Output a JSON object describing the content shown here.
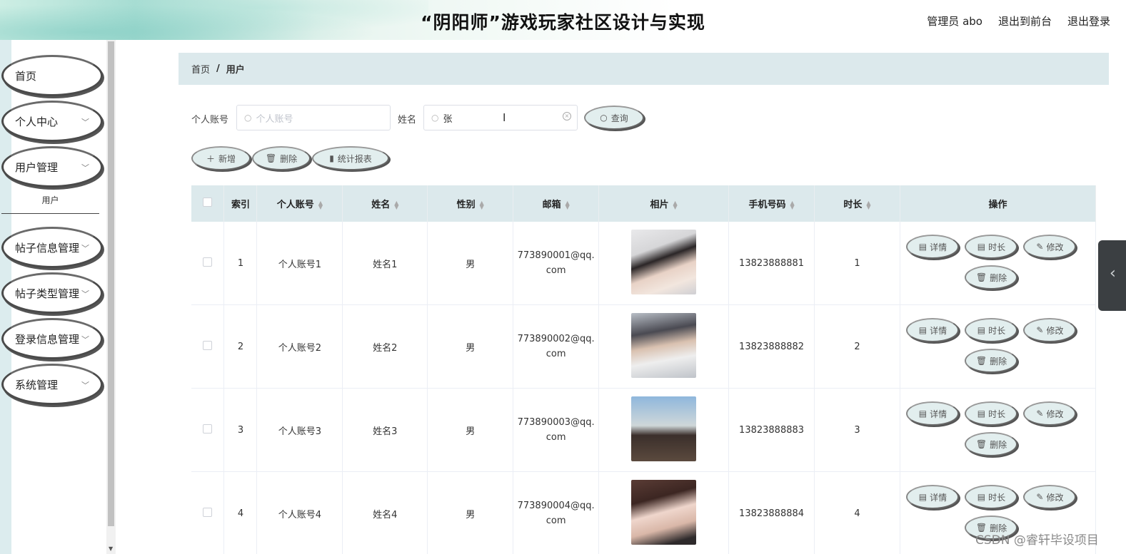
{
  "header": {
    "title": "“阴阳师”游戏玩家社区设计与实现",
    "admin": "管理员 abo",
    "to_front": "退出到前台",
    "logout": "退出登录"
  },
  "menu": {
    "items": [
      {
        "label": "首页"
      },
      {
        "label": "个人中心"
      },
      {
        "label": "用户管理"
      },
      {
        "label": "帖子信息管理"
      },
      {
        "label": "帖子类型管理"
      },
      {
        "label": "登录信息管理"
      },
      {
        "label": "系统管理"
      }
    ],
    "sub_item": "用户"
  },
  "breadcrumb": {
    "home": "首页",
    "sep": "/",
    "current": "用户"
  },
  "search": {
    "account_label": "个人账号",
    "account_placeholder": "个人账号",
    "name_label": "姓名",
    "name_value": "张",
    "query_label": "查询"
  },
  "actions": {
    "add": "新增",
    "delete": "删除",
    "report": "统计报表"
  },
  "table": {
    "headers": {
      "index": "索引",
      "account": "个人账号",
      "name": "姓名",
      "gender": "性别",
      "email": "邮箱",
      "photo": "相片",
      "phone": "手机号码",
      "duration": "时长",
      "ops": "操作"
    },
    "op_labels": {
      "detail": "详情",
      "duration": "时长",
      "edit": "修改",
      "delete": "删除"
    },
    "rows": [
      {
        "index": "1",
        "account": "个人账号1",
        "name": "姓名1",
        "gender": "男",
        "email1": "773890001@qq.",
        "email2": "com",
        "phone": "13823888881",
        "duration": "1"
      },
      {
        "index": "2",
        "account": "个人账号2",
        "name": "姓名2",
        "gender": "男",
        "email1": "773890002@qq.",
        "email2": "com",
        "phone": "13823888882",
        "duration": "2"
      },
      {
        "index": "3",
        "account": "个人账号3",
        "name": "姓名3",
        "gender": "男",
        "email1": "773890003@qq.",
        "email2": "com",
        "phone": "13823888883",
        "duration": "3"
      },
      {
        "index": "4",
        "account": "个人账号4",
        "name": "姓名4",
        "gender": "男",
        "email1": "773890004@qq.",
        "email2": "com",
        "phone": "13823888884",
        "duration": "4"
      }
    ]
  },
  "watermark": "CSDN @睿轩毕设项目"
}
